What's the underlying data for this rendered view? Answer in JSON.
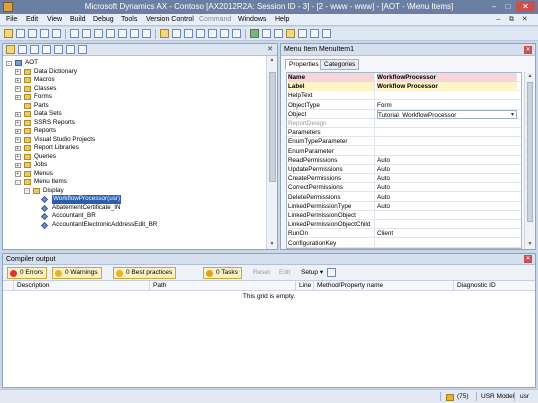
{
  "window": {
    "title": "Microsoft Dynamics AX - Contoso [AX2012R2A: Session ID - 3] -  [2 - www - www] - [AOT - \\Menu Items]"
  },
  "menubar": {
    "items": [
      {
        "label": "File",
        "enabled": true
      },
      {
        "label": "Edit",
        "enabled": true
      },
      {
        "label": "View",
        "enabled": true
      },
      {
        "label": "Build",
        "enabled": true
      },
      {
        "label": "Debug",
        "enabled": true
      },
      {
        "label": "Tools",
        "enabled": true
      },
      {
        "label": "Version Control",
        "enabled": true
      },
      {
        "label": "Command",
        "enabled": false
      },
      {
        "label": "Windows",
        "enabled": true
      },
      {
        "label": "Help",
        "enabled": true
      }
    ]
  },
  "aot": {
    "nodes": [
      {
        "label": "AOT",
        "icon": "aot-root-icon"
      },
      {
        "label": "Data Dictionary",
        "icon": "folder-icon"
      },
      {
        "label": "Macros",
        "icon": "folder-icon"
      },
      {
        "label": "Classes",
        "icon": "folder-icon"
      },
      {
        "label": "Forms",
        "icon": "folder-icon"
      },
      {
        "label": "Parts",
        "icon": "folder-icon"
      },
      {
        "label": "Data Sets",
        "icon": "folder-icon"
      },
      {
        "label": "SSRS Reports",
        "icon": "folder-icon"
      },
      {
        "label": "Reports",
        "icon": "folder-icon"
      },
      {
        "label": "Visual Studio Projects",
        "icon": "folder-icon"
      },
      {
        "label": "Report Libraries",
        "icon": "folder-icon"
      },
      {
        "label": "Queries",
        "icon": "folder-icon"
      },
      {
        "label": "Jobs",
        "icon": "folder-icon"
      },
      {
        "label": "Menus",
        "icon": "folder-icon"
      },
      {
        "label": "Menu Items",
        "icon": "folder-icon"
      },
      {
        "label": "Display",
        "icon": "folder-icon"
      },
      {
        "label": "WorkflowProcessor(usr)",
        "icon": "menu-item-icon"
      },
      {
        "label": "AbatementCertificate_IN",
        "icon": "menu-item-icon"
      },
      {
        "label": "Accountant_BR",
        "icon": "menu-item-icon"
      },
      {
        "label": "AccountantElectronicAddressEdit_BR",
        "icon": "menu-item-icon"
      }
    ]
  },
  "properties": {
    "title": "Menu Item MenuItem1",
    "tabs": [
      "Properties",
      "Categories"
    ],
    "rows": [
      {
        "name": "Name",
        "value": "WorkflowProcessor"
      },
      {
        "name": "Label",
        "value": "Workflow Processor"
      },
      {
        "name": "HelpText",
        "value": ""
      },
      {
        "name": "ObjectType",
        "value": "Form"
      },
      {
        "name": "Object",
        "value": "Tutorial_WorkflowProcessor"
      },
      {
        "name": "ReportDesign",
        "value": ""
      },
      {
        "name": "Parameters",
        "value": ""
      },
      {
        "name": "EnumTypeParameter",
        "value": ""
      },
      {
        "name": "EnumParameter",
        "value": ""
      },
      {
        "name": "ReadPermissions",
        "value": "Auto"
      },
      {
        "name": "UpdatePermissions",
        "value": "Auto"
      },
      {
        "name": "CreatePermissions",
        "value": "Auto"
      },
      {
        "name": "CorrectPermissions",
        "value": "Auto"
      },
      {
        "name": "DeletePermissions",
        "value": "Auto"
      },
      {
        "name": "LinkedPermissionType",
        "value": "Auto"
      },
      {
        "name": "LinkedPermissionObject",
        "value": ""
      },
      {
        "name": "LinkedPermissionObjectChild",
        "value": ""
      },
      {
        "name": "RunOn",
        "value": "Client"
      },
      {
        "name": "ConfigurationKey",
        "value": ""
      }
    ]
  },
  "compiler": {
    "title": "Compiler output",
    "filters": [
      {
        "label": "0 Errors",
        "icon": "error-icon"
      },
      {
        "label": "0 Warnings",
        "icon": "warning-icon"
      },
      {
        "label": "0 Best practices",
        "icon": "best-practice-icon"
      },
      {
        "label": "0 Tasks",
        "icon": "task-icon"
      }
    ],
    "actions": {
      "reset": "Reset",
      "edit": "Edit",
      "setup": "Setup"
    },
    "columns": [
      "Description",
      "Path",
      "Line",
      "Method/Property name",
      "Diagnostic ID"
    ],
    "empty_message": "This grid is empty."
  },
  "statusbar": {
    "count": "(75)",
    "model": "USR Model",
    "layer": "usr"
  }
}
